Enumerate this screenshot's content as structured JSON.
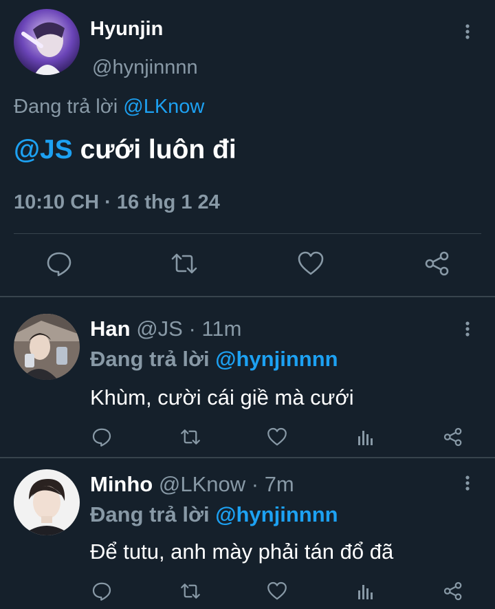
{
  "main_tweet": {
    "name": "Hyunjin",
    "handle": "@hynjinnnn",
    "reply_prefix": "Đang trả lời",
    "reply_to": "@LKnow",
    "mention": "@JS",
    "text": " cưới luôn đi",
    "timestamp": "10:10 CH · 16 thg 1 24",
    "actions": [
      "reply-icon",
      "retweet-icon",
      "like-icon",
      "share-icon"
    ]
  },
  "replies": [
    {
      "name": "Han",
      "handle": "@JS",
      "time": " · 11m",
      "reply_prefix": "Đang trả lời",
      "reply_to": "@hynjinnnn",
      "text": "Khùm, cười cái giề mà cưới"
    },
    {
      "name": "Minho",
      "handle": "@LKnow",
      "time": " · 7m",
      "reply_prefix": "Đang trả lời",
      "reply_to": "@hynjinnnn",
      "text": "Để tutu, anh mày phải tán đổ đã"
    }
  ],
  "colors": {
    "background": "#15202b",
    "accent": "#1da1f2",
    "muted": "#8899a6",
    "divider": "#38444d"
  }
}
